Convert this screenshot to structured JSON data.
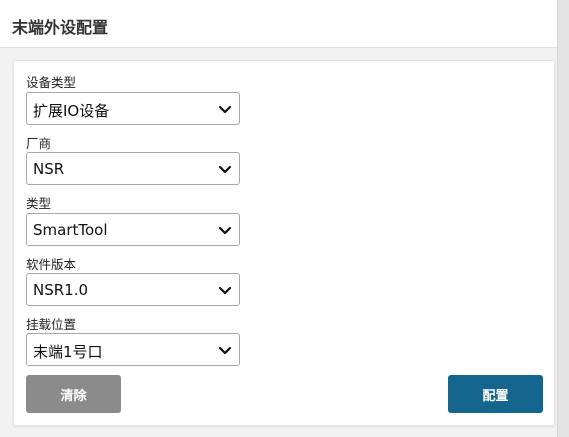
{
  "header": {
    "title": "末端外设配置"
  },
  "form": {
    "fields": [
      {
        "label": "设备类型",
        "value": "扩展IO设备"
      },
      {
        "label": "厂商",
        "value": "NSR"
      },
      {
        "label": "类型",
        "value": "SmartTool"
      },
      {
        "label": "软件版本",
        "value": "NSR1.0"
      },
      {
        "label": "挂载位置",
        "value": "末端1号口"
      }
    ]
  },
  "buttons": {
    "clear_label": "清除",
    "config_label": "配置"
  },
  "colors": {
    "config_button": "#14668f",
    "clear_button": "#8b8b8b"
  },
  "icons": {
    "dropdown": "chevron-down-icon"
  }
}
